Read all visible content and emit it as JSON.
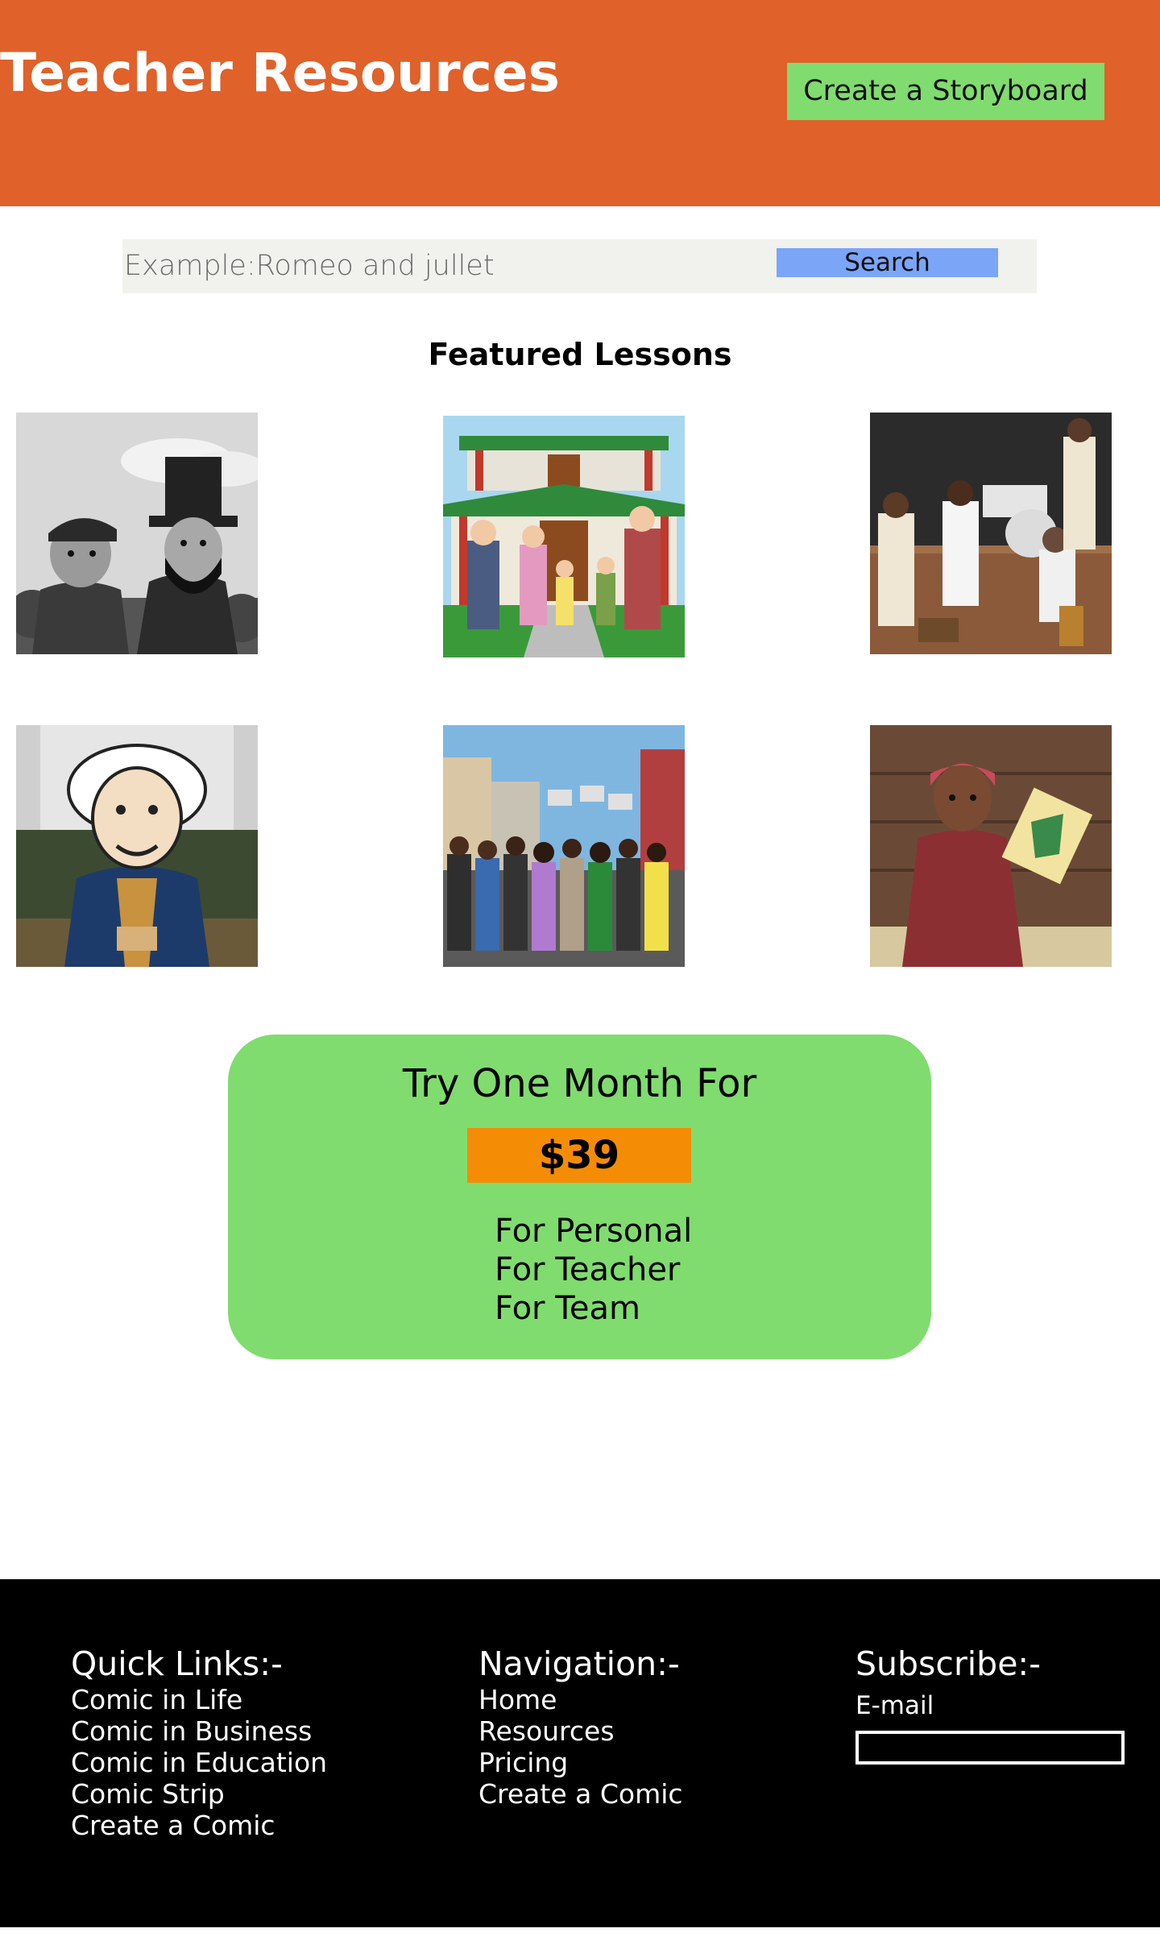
{
  "header": {
    "title": "Teacher Resources",
    "cta_label": "Create a Storyboard"
  },
  "search": {
    "placeholder": "Example:Romeo and jullet",
    "button_label": "Search"
  },
  "featured": {
    "title": "Featured Lessons",
    "lessons": [
      {
        "icon": "civil-war-lincoln-illustration"
      },
      {
        "icon": "chinese-palace-illustration"
      },
      {
        "icon": "jazz-band-stage-illustration"
      },
      {
        "icon": "george-washington-illustration"
      },
      {
        "icon": "civil-rights-march-illustration"
      },
      {
        "icon": "woman-with-map-illustration"
      }
    ]
  },
  "pricing": {
    "headline": "Try One Month For",
    "price": "$39",
    "plans": [
      "For Personal",
      "For Teacher",
      "For Team"
    ]
  },
  "footer": {
    "quick_links": {
      "title": "Quick Links:-",
      "items": [
        "Comic in Life",
        "Comic in Business",
        "Comic in Education",
        "Comic Strip",
        "Create a Comic"
      ]
    },
    "navigation": {
      "title": "Navigation:-",
      "items": [
        "Home",
        "Resources",
        "Pricing",
        "Create a Comic"
      ]
    },
    "subscribe": {
      "title": "Subscribe:-",
      "email_label": "E-mail"
    }
  },
  "colors": {
    "header_bg": "#e0612a",
    "cta_bg": "#80dc6f",
    "search_btn_bg": "#7ba5f7",
    "price_card_bg": "#80dc6f",
    "price_badge_bg": "#f48c06",
    "footer_bg": "#000000"
  }
}
